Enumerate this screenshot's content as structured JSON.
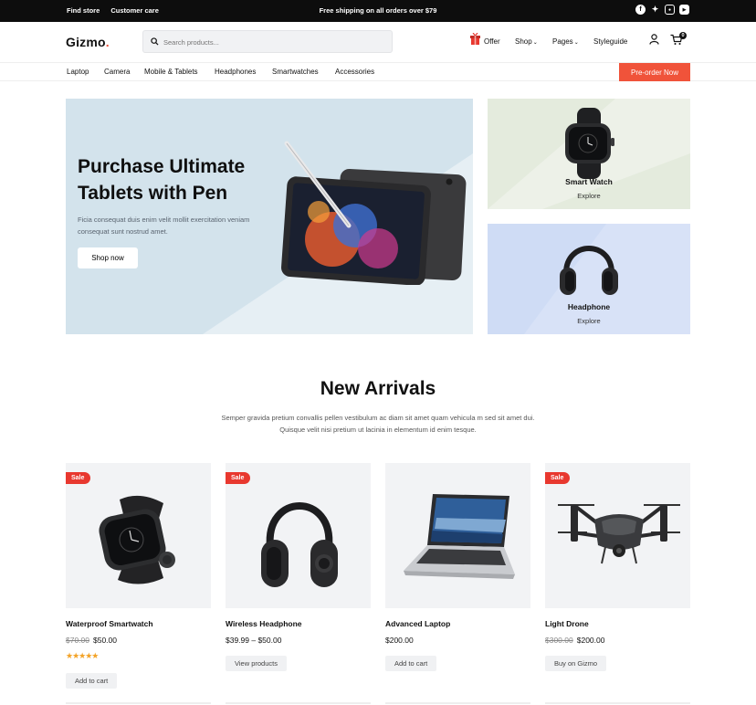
{
  "topbar": {
    "find_store": "Find store",
    "customer_care": "Customer care",
    "shipping": "Free shipping on all orders over $79",
    "social": [
      "facebook-icon",
      "twitter-icon",
      "instagram-icon",
      "youtube-icon"
    ]
  },
  "header": {
    "logo": "Gizmo",
    "logo_dot": ".",
    "search_placeholder": "Search products...",
    "offer": "Offer",
    "shop": "Shop",
    "pages": "Pages",
    "styleguide": "Styleguide",
    "cart_count": "0"
  },
  "categories": [
    "Laptop",
    "Camera",
    "Mobile & Tablets",
    "Headphones",
    "Smartwatches",
    "Accessories"
  ],
  "preorder": "Pre-order Now",
  "hero": {
    "title_line1": "Purchase Ultimate",
    "title_line2": "Tablets with Pen",
    "desc": "Ficia consequat duis enim velit mollit exercitation veniam consequat sunt nostrud amet.",
    "button": "Shop now"
  },
  "promos": [
    {
      "title": "Smart Watch",
      "link": "Explore"
    },
    {
      "title": "Headphone",
      "link": "Explore"
    }
  ],
  "new_arrivals": {
    "title": "New Arrivals",
    "subtitle": "Semper gravida pretium convallis pellen vestibulum ac diam sit amet quam vehicula m sed sit amet dui. Quisque velit nisi pretium ut lacinia in elementum id enim tesque."
  },
  "products": [
    {
      "name": "Waterproof Smartwatch",
      "old_price": "$70.00",
      "price": "$50.00",
      "sale": "Sale",
      "rating": 5,
      "stars": "★★★★★",
      "button": "Add to cart"
    },
    {
      "name": "Wireless Headphone",
      "old_price": "",
      "price": "$39.99 – $50.00",
      "sale": "Sale",
      "button": "View products"
    },
    {
      "name": "Advanced Laptop",
      "old_price": "",
      "price": "$200.00",
      "sale": "",
      "button": "Add to cart"
    },
    {
      "name": "Light Drone",
      "old_price": "$300.00",
      "price": "$200.00",
      "sale": "Sale",
      "button": "Buy on Gizmo"
    }
  ],
  "colors": {
    "accent": "#f0533a",
    "sale": "#e8382f",
    "hero_bg": "#d3e3ec",
    "promo1_bg": "#e4ebdd",
    "promo2_bg": "#cfdcf5",
    "star": "#f3a327"
  }
}
